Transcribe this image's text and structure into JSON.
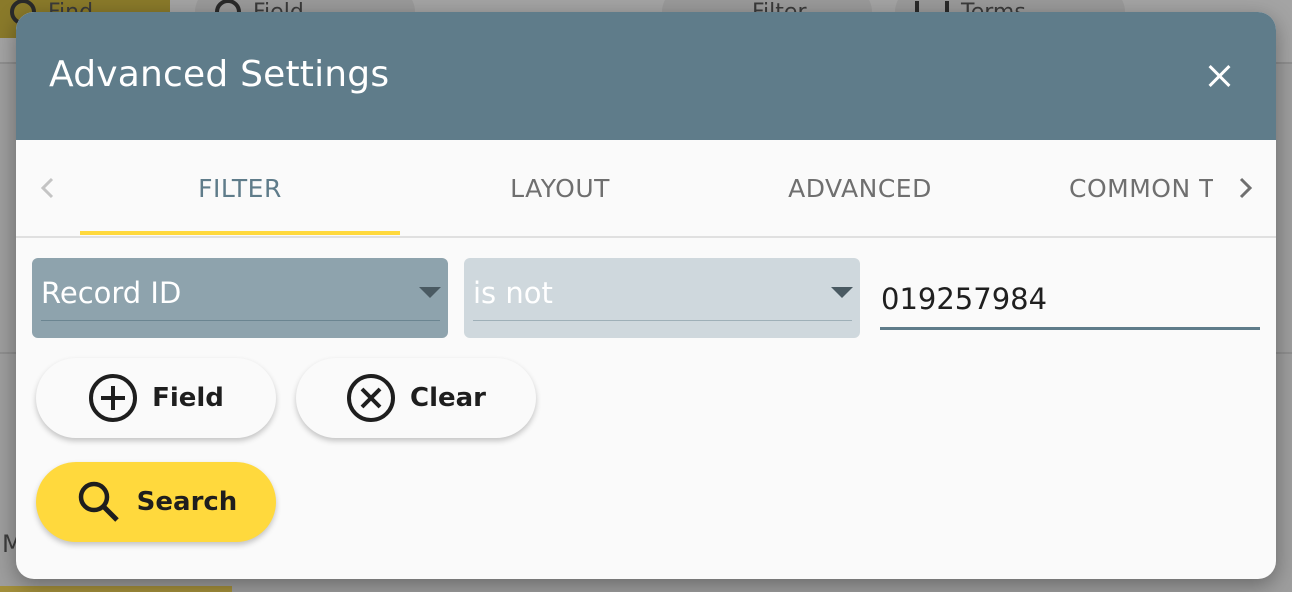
{
  "background": {
    "toolbar_buttons": [
      "Find",
      "Field",
      "Filter",
      "Terms"
    ],
    "stray_text": "M"
  },
  "dialog": {
    "title": "Advanced Settings",
    "close_icon": "close-icon",
    "tabs": [
      {
        "label": "FILTER",
        "active": true
      },
      {
        "label": "LAYOUT",
        "active": false
      },
      {
        "label": "ADVANCED",
        "active": false
      },
      {
        "label": "COMMON T",
        "active": false
      }
    ],
    "filter": {
      "field_select_value": "Record ID",
      "operator_select_value": "is not",
      "value_input": "019257984"
    },
    "buttons": {
      "add_field_label": "Field",
      "clear_label": "Clear",
      "search_label": "Search"
    }
  },
  "colors": {
    "header": "#5f7c8a",
    "accent": "#ffd93d",
    "field_select": "#8ea3ad",
    "operator_select": "#cfd8dd"
  }
}
